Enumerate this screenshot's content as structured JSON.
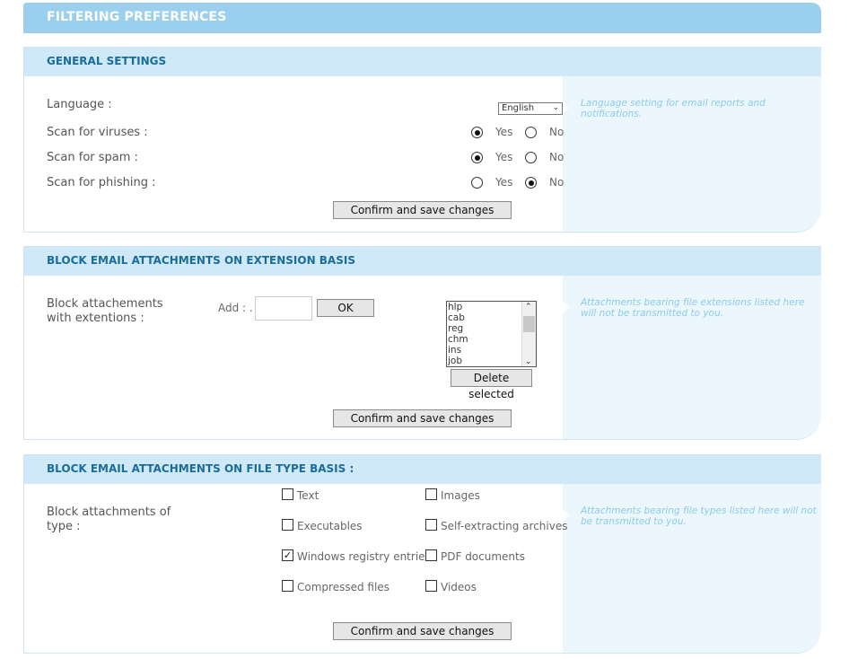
{
  "header": {
    "title": "FILTERING PREFERENCES"
  },
  "general": {
    "title": "GENERAL SETTINGS",
    "language_label": "Language :",
    "language_value": "English",
    "viruses_label": "Scan for viruses :",
    "spam_label": "Scan for spam :",
    "phishing_label": "Scan for phishing :",
    "yes": "Yes",
    "no": "No",
    "viruses": "yes",
    "spam": "yes",
    "phishing": "no",
    "help": "Language setting for email reports and notifications.",
    "save": "Confirm and save changes"
  },
  "extensions": {
    "title": "BLOCK EMAIL ATTACHMENTS ON EXTENSION BASIS",
    "label_line1": "Block attachements",
    "label_line2": "with extentions :",
    "add_label": "Add : .",
    "add_value": "",
    "ok": "OK",
    "list": [
      "hlp",
      "cab",
      "reg",
      "chm",
      "ins",
      "job"
    ],
    "delete": "Delete selected",
    "help": "Attachments bearing file extensions listed here will not be transmitted to you.",
    "save": "Confirm and save changes"
  },
  "filetypes": {
    "title": "BLOCK EMAIL ATTACHMENTS ON FILE TYPE BASIS :",
    "label_line1": "Block attachments of",
    "label_line2": "type :",
    "types": [
      {
        "label": "Text",
        "checked": false
      },
      {
        "label": "Images",
        "checked": false
      },
      {
        "label": "Executables",
        "checked": false
      },
      {
        "label": "Self-extracting archives",
        "checked": false
      },
      {
        "label": "Windows registry entries",
        "checked": true
      },
      {
        "label": "PDF documents",
        "checked": false
      },
      {
        "label": "Compressed files",
        "checked": false
      },
      {
        "label": "Videos",
        "checked": false
      }
    ],
    "help": "Attachments bearing file types listed here will not be transmitted to you.",
    "save": "Confirm and save changes"
  }
}
